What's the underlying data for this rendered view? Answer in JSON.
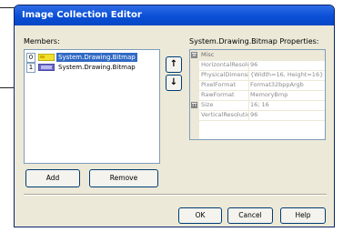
{
  "dialog": {
    "title": "Image Collection Editor",
    "members_label": "Members:",
    "properties_label": "System.Drawing.Bitmap Properties:"
  },
  "members": [
    {
      "index": "0",
      "name": "System.Drawing.Bitmap",
      "selected": true
    },
    {
      "index": "1",
      "name": "System.Drawing.Bitmap",
      "selected": false
    }
  ],
  "move_buttons": {
    "up": "↑",
    "down": "↓"
  },
  "buttons": {
    "add": "Add",
    "remove": "Remove",
    "ok": "OK",
    "cancel": "Cancel",
    "help": "Help"
  },
  "properties": {
    "category": "Misc",
    "rows": [
      {
        "name": "HorizontalResolu",
        "value": "96"
      },
      {
        "name": "PhysicalDimensio",
        "value": "{Width=16, Height=16}"
      },
      {
        "name": "PixelFormat",
        "value": "Format32bppArgb"
      },
      {
        "name": "RawFormat",
        "value": "MemoryBmp"
      },
      {
        "name": "Size",
        "value": "16; 16"
      },
      {
        "name": "VerticalResolutio",
        "value": "96"
      }
    ],
    "expand_glyph": "⊟",
    "size_expand_glyph": "⊞"
  }
}
